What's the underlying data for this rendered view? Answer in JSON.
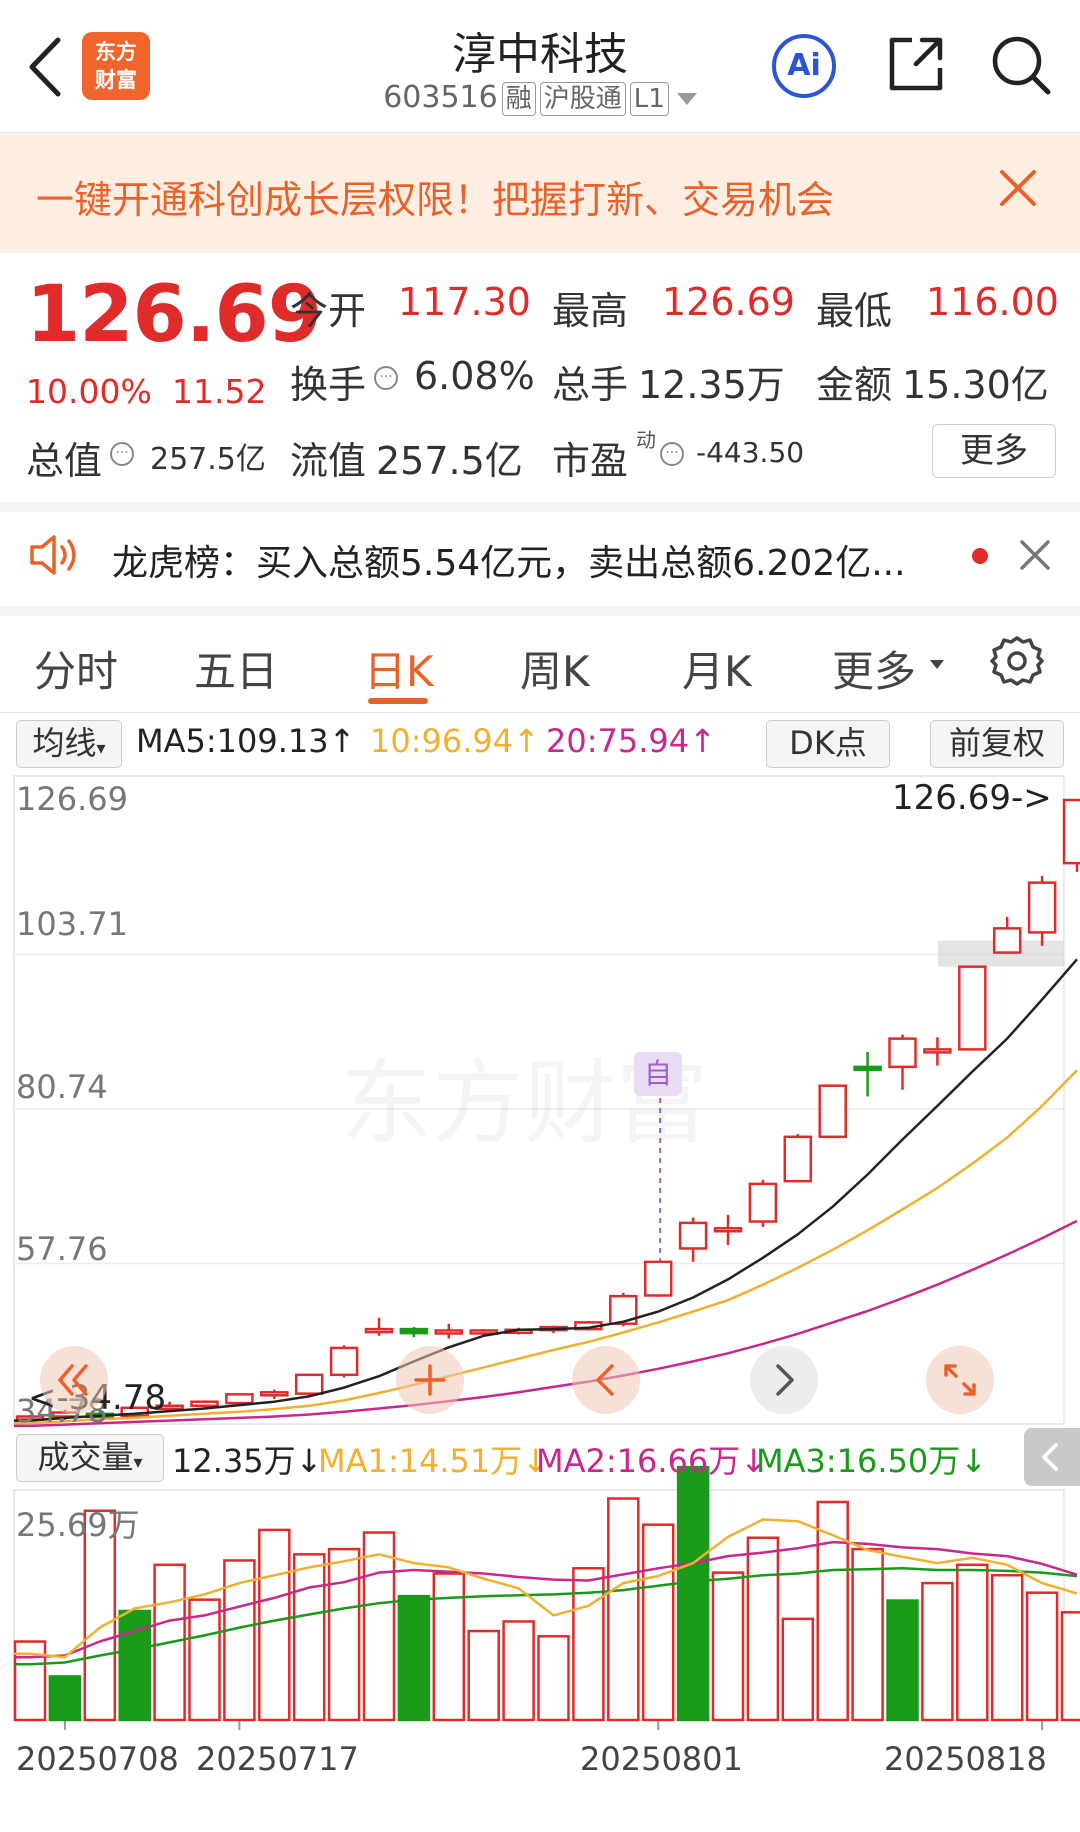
{
  "header": {
    "logo_line1": "东方",
    "logo_line2": "财富",
    "stock_name": "淳中科技",
    "stock_code": "603516",
    "tag_rong": "融",
    "tag_hugutong": "沪股通",
    "tag_level": "L1",
    "ai_label": "Ai"
  },
  "banner": {
    "text": "一键开通科创成长层权限！把握打新、交易机会"
  },
  "quote": {
    "price": "126.69",
    "change_pct": "10.00%",
    "change": "11.52",
    "open_label": "今开",
    "open": "117.30",
    "high_label": "最高",
    "high": "126.69",
    "low_label": "最低",
    "low": "116.00",
    "turnover_label": "换手",
    "turnover": "6.08%",
    "volume_label": "总手",
    "volume": "12.35万",
    "amount_label": "金额",
    "amount": "15.30亿",
    "mktcap_label": "总值",
    "mktcap": "257.5亿",
    "float_label": "流值",
    "float": "257.5亿",
    "pe_label": "市盈",
    "pe_sup": "动",
    "pe": "-443.50",
    "more_label": "更多"
  },
  "notice": {
    "text": "龙虎榜：买入总额5.54亿元，卖出总额6.202亿..."
  },
  "tabs": [
    "分时",
    "五日",
    "日K",
    "周K",
    "月K",
    "更多"
  ],
  "kline": {
    "ma_selector": "均线",
    "ma5": "MA5:109.13↑",
    "ma10": "10:96.94↑",
    "ma20": "20:75.94↑",
    "dk_label": "DK点",
    "adjust_label": "前复权",
    "y_labels": [
      "126.69",
      "103.71",
      "80.74",
      "57.76",
      "34.78"
    ],
    "last_price_label": "126.69->",
    "min_price_label": "<-34.78",
    "marker_label": "自",
    "watermark": "东方财富"
  },
  "volume": {
    "selector": "成交量",
    "value": "12.35万↓",
    "ma1": "MA1:14.51万↓",
    "ma2": "MA2:16.66万↓",
    "ma3": "MA3:16.50万↓",
    "y_max": "25.69万"
  },
  "dates": [
    "20250708",
    "20250717",
    "20250801",
    "20250818"
  ],
  "colors": {
    "up": "#e02b2b",
    "down": "#1a9a1a",
    "ma5": "#222222",
    "ma10": "#f0b030",
    "ma20": "#c8288c",
    "accent": "#e9622a"
  },
  "chart_data": {
    "type": "candlestick",
    "ylim": [
      34.78,
      126.69
    ],
    "candles": [
      {
        "o": 34.6,
        "h": 35.2,
        "l": 34.2,
        "c": 35.0
      },
      {
        "o": 35.0,
        "h": 36.0,
        "l": 34.5,
        "c": 35.6
      },
      {
        "o": 35.4,
        "h": 35.8,
        "l": 34.9,
        "c": 35.2
      },
      {
        "o": 35.1,
        "h": 36.5,
        "l": 34.8,
        "c": 36.3
      },
      {
        "o": 36.3,
        "h": 37.2,
        "l": 35.9,
        "c": 36.6
      },
      {
        "o": 36.6,
        "h": 37.4,
        "l": 36.2,
        "c": 37.2
      },
      {
        "o": 37.0,
        "h": 38.4,
        "l": 36.6,
        "c": 38.3
      },
      {
        "o": 38.2,
        "h": 39.0,
        "l": 37.6,
        "c": 38.6
      },
      {
        "o": 38.4,
        "h": 41.4,
        "l": 38.0,
        "c": 41.2
      },
      {
        "o": 41.2,
        "h": 45.6,
        "l": 40.8,
        "c": 45.2
      },
      {
        "o": 48.0,
        "h": 49.7,
        "l": 47.0,
        "c": 48.0
      },
      {
        "o": 48.0,
        "h": 48.3,
        "l": 46.8,
        "c": 47.4
      },
      {
        "o": 47.8,
        "h": 48.8,
        "l": 46.6,
        "c": 47.8
      },
      {
        "o": 47.6,
        "h": 48.0,
        "l": 47.0,
        "c": 47.8
      },
      {
        "o": 47.6,
        "h": 48.2,
        "l": 47.2,
        "c": 47.9
      },
      {
        "o": 48.0,
        "h": 48.5,
        "l": 47.4,
        "c": 48.3
      },
      {
        "o": 48.0,
        "h": 49.2,
        "l": 47.8,
        "c": 49.0
      },
      {
        "o": 48.8,
        "h": 53.4,
        "l": 48.4,
        "c": 52.9
      },
      {
        "o": 53.0,
        "h": 58.0,
        "l": 52.8,
        "c": 58.0
      },
      {
        "o": 60.0,
        "h": 64.6,
        "l": 58.0,
        "c": 63.8
      },
      {
        "o": 63.0,
        "h": 65.0,
        "l": 60.5,
        "c": 63.0
      },
      {
        "o": 64.0,
        "h": 70.2,
        "l": 63.2,
        "c": 69.6
      },
      {
        "o": 70.0,
        "h": 77.0,
        "l": 69.8,
        "c": 76.6
      },
      {
        "o": 76.6,
        "h": 84.2,
        "l": 76.4,
        "c": 84.2
      },
      {
        "o": 87.0,
        "h": 89.2,
        "l": 82.6,
        "c": 86.8
      },
      {
        "o": 87.0,
        "h": 91.8,
        "l": 83.6,
        "c": 91.2
      },
      {
        "o": 89.6,
        "h": 91.4,
        "l": 87.2,
        "c": 89.6
      },
      {
        "o": 89.6,
        "h": 102.0,
        "l": 89.6,
        "c": 101.9
      },
      {
        "o": 104.0,
        "h": 109.3,
        "l": 104.0,
        "c": 107.6
      },
      {
        "o": 107.0,
        "h": 115.4,
        "l": 105.0,
        "c": 114.4
      },
      {
        "o": 117.3,
        "h": 126.69,
        "l": 116.0,
        "c": 126.69
      }
    ],
    "ma5": [
      34.4,
      34.8,
      35.1,
      35.4,
      35.8,
      36.2,
      36.7,
      37.2,
      38.0,
      39.3,
      41.0,
      43.2,
      45.3,
      47.0,
      47.9,
      48.0,
      48.2,
      49.1,
      50.6,
      52.7,
      55.4,
      58.6,
      62.1,
      66.2,
      71.0,
      76.2,
      81.2,
      86.3,
      91.2,
      97.0,
      103.0
    ],
    "ma10": [
      34.0,
      34.3,
      34.6,
      34.8,
      35.1,
      35.4,
      35.7,
      36.1,
      36.6,
      37.4,
      38.5,
      39.7,
      41.0,
      42.3,
      43.6,
      44.9,
      46.1,
      47.5,
      49.0,
      50.6,
      52.3,
      54.6,
      57.1,
      59.8,
      62.7,
      65.8,
      69.0,
      72.6,
      76.5,
      81.2,
      86.5
    ],
    "ma20": [
      33.6,
      33.8,
      34.0,
      34.2,
      34.4,
      34.6,
      34.8,
      35.0,
      35.3,
      35.7,
      36.2,
      36.7,
      37.3,
      37.9,
      38.6,
      39.4,
      40.2,
      41.1,
      42.1,
      43.2,
      44.4,
      45.8,
      47.3,
      49.0,
      50.7,
      52.6,
      54.6,
      56.8,
      59.1,
      61.5,
      64.1
    ],
    "volume_ymax": 25.69,
    "volume_unit": "万",
    "volume": [
      9.0,
      5.0,
      24.0,
      12.5,
      17.8,
      13.8,
      18.3,
      21.8,
      19.0,
      19.6,
      21.5,
      14.2,
      16.8,
      10.2,
      11.3,
      9.6,
      17.4,
      25.4,
      22.4,
      29.0,
      16.9,
      20.9,
      11.6,
      25.0,
      19.6,
      13.7,
      15.7,
      17.8,
      16.6,
      14.6,
      12.35
    ],
    "volume_up": [
      true,
      false,
      true,
      false,
      true,
      true,
      true,
      true,
      true,
      true,
      true,
      false,
      true,
      true,
      true,
      true,
      true,
      true,
      true,
      false,
      true,
      true,
      true,
      true,
      true,
      false,
      true,
      true,
      true,
      true,
      true
    ],
    "vol_ma1": [
      7.6,
      7.2,
      10.6,
      12.8,
      13.5,
      14.4,
      15.7,
      16.6,
      17.5,
      18.2,
      19.0,
      18.0,
      17.5,
      16.2,
      15.1,
      12.0,
      13.1,
      15.7,
      16.5,
      18.0,
      21.0,
      23.0,
      22.8,
      21.2,
      19.5,
      18.7,
      18.0,
      18.6,
      17.8,
      15.7,
      14.51
    ],
    "vol_ma2": [
      7.2,
      7.4,
      9.0,
      10.2,
      11.4,
      12.0,
      13.0,
      14.0,
      15.2,
      15.8,
      16.9,
      17.2,
      17.0,
      16.8,
      16.4,
      16.1,
      16.0,
      16.7,
      17.4,
      18.0,
      18.8,
      19.2,
      19.7,
      20.4,
      20.2,
      19.8,
      19.6,
      19.1,
      18.8,
      17.9,
      16.66
    ],
    "vol_ma3": [
      6.4,
      6.6,
      7.4,
      8.1,
      8.9,
      9.7,
      10.6,
      11.4,
      12.1,
      12.8,
      13.4,
      13.8,
      14.0,
      14.2,
      14.3,
      14.4,
      14.6,
      14.9,
      15.4,
      15.9,
      16.2,
      16.6,
      16.8,
      17.2,
      17.3,
      17.4,
      17.2,
      17.2,
      17.1,
      16.9,
      16.5
    ]
  }
}
